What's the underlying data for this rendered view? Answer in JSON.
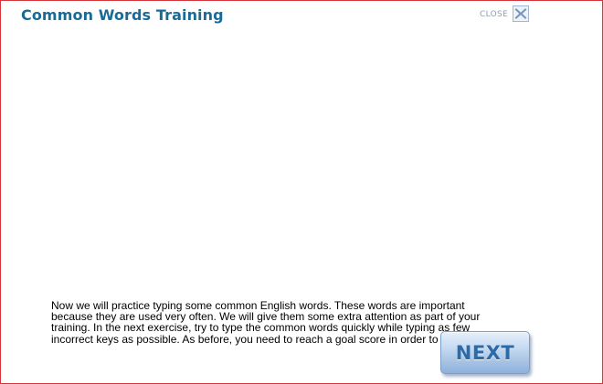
{
  "dialog": {
    "title": "Common Words Training",
    "close_label": "CLOSE",
    "close_icon": "close-x-icon",
    "paragraph": "Now we will practice typing some common English words. These words are important because they are used very often. We will give them some extra attention as part of your training. In the next exercise, try to type the common words quickly while typing as few incorrect keys as possible. As before, you need to reach a goal score in order to continue.",
    "next_label": "NEXT"
  },
  "colors": {
    "title": "#1a6a97",
    "border": "#d4343a",
    "close_icon": "#7f9cc4",
    "next_text": "#2d6aa8"
  }
}
